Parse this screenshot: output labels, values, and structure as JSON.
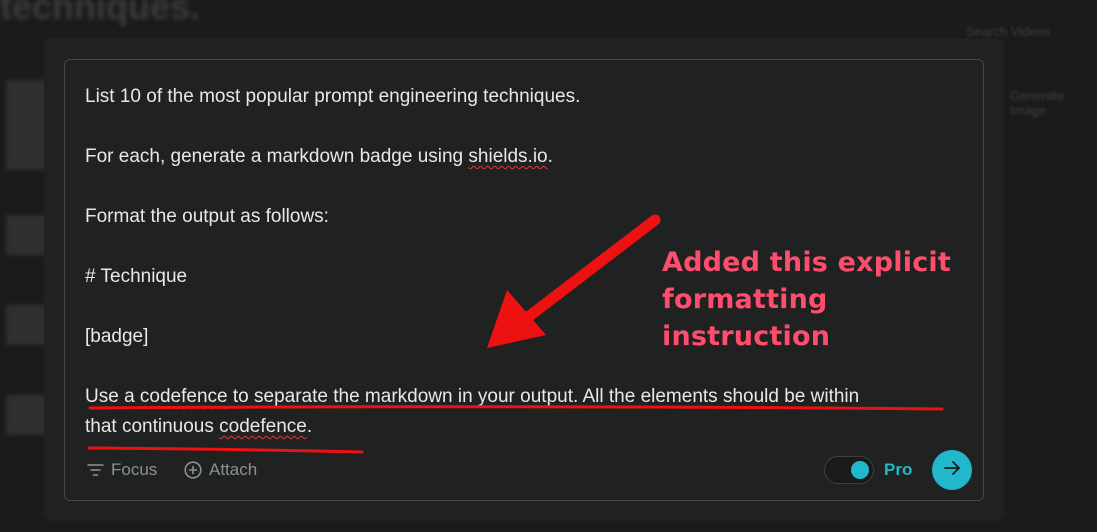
{
  "background": {
    "heading_fragment": "techniques.",
    "side_link_1": "Search Videos",
    "side_link_2": "Generate Image"
  },
  "prompt": {
    "lines": [
      "List 10 of the most popular prompt engineering techniques.",
      "",
      "For each, generate a markdown badge using shields.io.",
      "",
      "Format the output as follows:",
      "",
      "# Technique",
      "",
      "[badge]",
      "",
      "Use a codefence to separate the markdown in your output. All the elements should be within",
      "that continuous codefence."
    ],
    "spellcheck_words": [
      "shields.io",
      "codefence"
    ]
  },
  "toolbar": {
    "focus_label": "Focus",
    "attach_label": "Attach",
    "focus_icon": "filter-lines-icon",
    "attach_icon": "plus-circle-icon",
    "pro_label": "Pro",
    "pro_enabled": true,
    "send_icon": "arrow-right-icon"
  },
  "annotation": {
    "line1": "Added this explicit",
    "line2": "formatting instruction",
    "color": "#ff4d6d",
    "arrow_color": "#ee1111"
  },
  "colors": {
    "accent": "#21b8cd",
    "panel": "#202222",
    "text": "#e8e8e6",
    "muted": "#8e9191"
  }
}
